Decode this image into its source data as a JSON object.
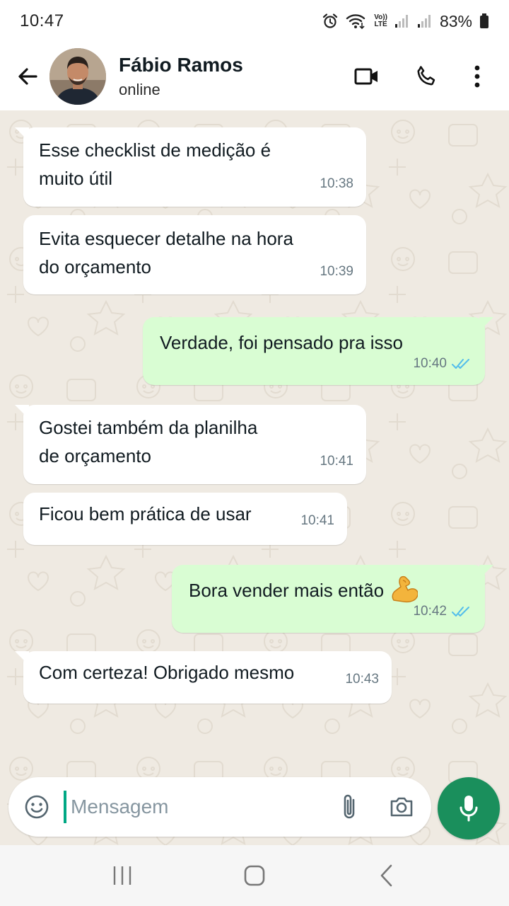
{
  "status_bar": {
    "time": "10:47",
    "lte_top": "Vo))",
    "lte_bottom": "LTE",
    "battery": "83%"
  },
  "header": {
    "contact_name": "Fábio Ramos",
    "contact_status": "online"
  },
  "messages": [
    {
      "direction": "in",
      "text": "Esse checklist de medição é\nmuito útil",
      "time": "10:38"
    },
    {
      "direction": "in",
      "text": "Evita esquecer detalhe na hora\ndo orçamento",
      "time": "10:39"
    },
    {
      "direction": "out",
      "text": "Verdade, foi pensado pra isso",
      "time": "10:40",
      "read": true
    },
    {
      "direction": "in",
      "text": "Gostei também da planilha\nde orçamento",
      "time": "10:41"
    },
    {
      "direction": "in",
      "text": "Ficou bem prática de usar",
      "time": "10:41"
    },
    {
      "direction": "out",
      "text": "Bora vender mais então",
      "emoji": "flexed-biceps",
      "time": "10:42",
      "read": true
    },
    {
      "direction": "in",
      "text": "Com certeza! Obrigado mesmo",
      "time": "10:43"
    }
  ],
  "composer": {
    "placeholder": "Mensagem"
  },
  "colors": {
    "accent": "#1a8f5c",
    "outgoing_bubble": "#d9fdd3",
    "chat_background": "#efeae2",
    "read_ticks": "#53bdeb"
  }
}
